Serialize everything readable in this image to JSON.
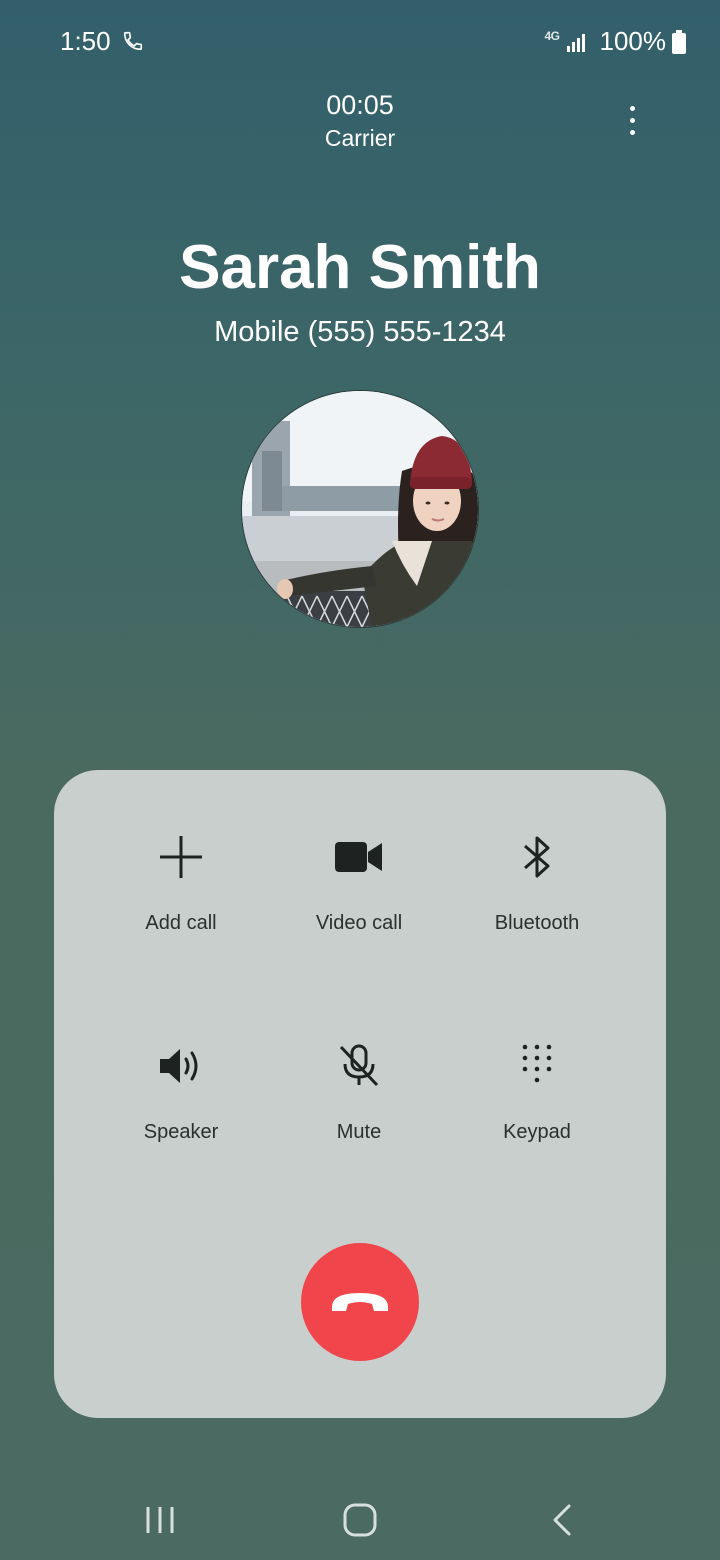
{
  "status_bar": {
    "time": "1:50",
    "network": "4G",
    "battery": "100%"
  },
  "call": {
    "timer": "00:05",
    "carrier": "Carrier"
  },
  "contact": {
    "name": "Sarah Smith",
    "number": "Mobile (555) 555-1234"
  },
  "controls": {
    "add_call": "Add call",
    "video_call": "Video call",
    "bluetooth": "Bluetooth",
    "speaker": "Speaker",
    "mute": "Mute",
    "keypad": "Keypad"
  },
  "icons": {
    "status": [
      "phone-call-icon",
      "signal-icon",
      "battery-icon"
    ],
    "controls": [
      "plus-icon",
      "video-camera-icon",
      "bluetooth-icon",
      "speaker-icon",
      "mic-off-icon",
      "keypad-icon"
    ],
    "end": "end-call-icon",
    "nav": [
      "recent-apps-icon",
      "home-icon",
      "back-icon"
    ]
  },
  "colors": {
    "end_call": "#f0454a",
    "panel": "#c9cfcd",
    "background_top": "#325f6b",
    "background_bottom": "#4b6a61"
  }
}
